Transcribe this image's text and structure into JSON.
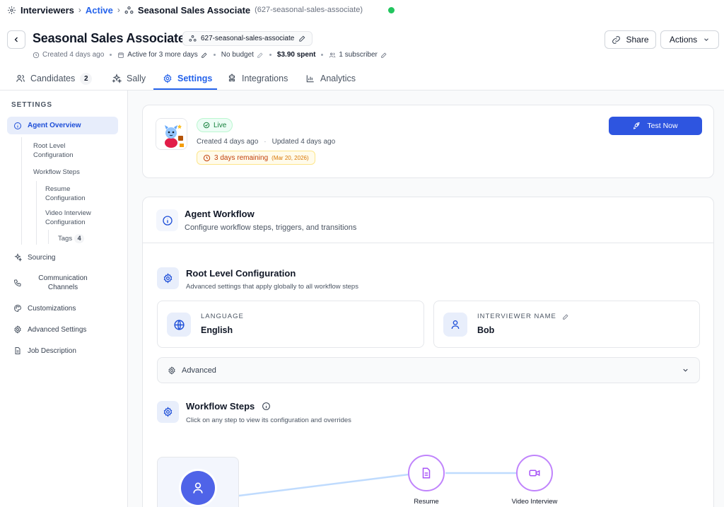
{
  "breadcrumb": {
    "root": "Interviewers",
    "status": "Active",
    "name": "Seasonal Sales Associate",
    "slug": "(627-seasonal-sales-associate)"
  },
  "header": {
    "title": "Seasonal Sales Associate",
    "slug": "627-seasonal-sales-associate",
    "meta": {
      "created": "Created 4 days ago",
      "active_for": "Active for 3 more days",
      "budget": "No budget",
      "spent": "$3.90 spent",
      "subscribers": "1 subscriber"
    },
    "share_label": "Share",
    "actions_label": "Actions"
  },
  "tabs": [
    {
      "label": "Candidates",
      "count": "2"
    },
    {
      "label": "Sally"
    },
    {
      "label": "Settings",
      "selected": true
    },
    {
      "label": "Integrations"
    },
    {
      "label": "Analytics"
    }
  ],
  "sidebar": {
    "heading": "SETTINGS",
    "items": {
      "agent_overview": "Agent Overview",
      "root_level_1": "Root Level",
      "root_level_2": "Configuration",
      "workflow_steps": "Workflow Steps",
      "resume_1": "Resume",
      "resume_2": "Configuration",
      "video_1": "Video Interview",
      "video_2": "Configuration",
      "tags": "Tags",
      "tags_count": "4",
      "sourcing": "Sourcing",
      "comm_1": "Communication",
      "comm_2": "Channels",
      "customizations": "Customizations",
      "advanced_settings": "Advanced Settings",
      "job_description": "Job Description"
    }
  },
  "overview": {
    "status": "Live",
    "created": "Created 4 days ago",
    "updated": "Updated 4 days ago",
    "remaining": "3 days remaining",
    "remaining_date": "(Mar 20, 2026)",
    "test_label": "Test Now"
  },
  "workflow": {
    "title": "Agent Workflow",
    "subtitle": "Configure workflow steps, triggers, and transitions",
    "root": {
      "title": "Root Level Configuration",
      "subtitle": "Advanced settings that apply globally to all workflow steps",
      "language_label": "LANGUAGE",
      "language_value": "English",
      "interviewer_label": "INTERVIEWER NAME",
      "interviewer_value": "Bob",
      "advanced_label": "Advanced"
    },
    "steps": {
      "title": "Workflow Steps",
      "subtitle": "Click on any step to view its configuration and overrides",
      "nodes": [
        "Resume",
        "Video Interview"
      ]
    }
  },
  "colors": {
    "accent": "#2563eb",
    "primary_button": "#2e55e0",
    "live_green": "#15803d",
    "warning": "#c2410c",
    "node_border": "#c084fc"
  }
}
